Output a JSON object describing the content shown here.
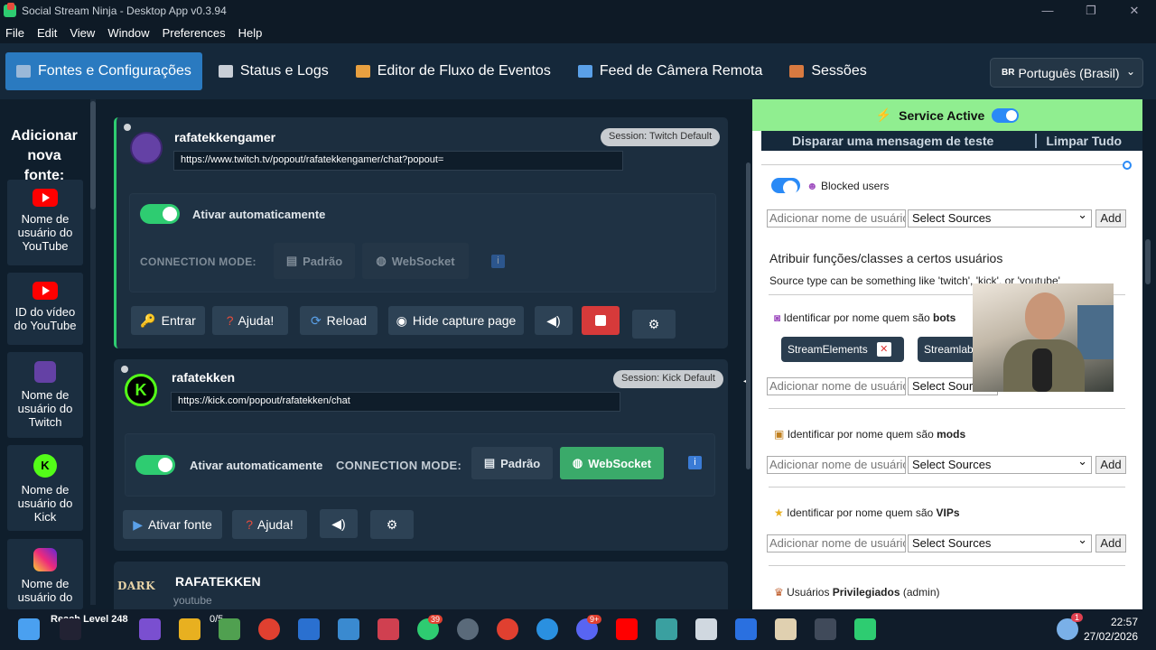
{
  "window": {
    "title": "Social Stream Ninja - Desktop App v0.3.94"
  },
  "menu": [
    "File",
    "Edit",
    "View",
    "Window",
    "Preferences",
    "Help"
  ],
  "tabs": [
    {
      "label": "Fontes e Configurações",
      "active": true
    },
    {
      "label": "Status e Logs"
    },
    {
      "label": "Editor de Fluxo de Eventos"
    },
    {
      "label": "Feed de Câmera Remota"
    },
    {
      "label": "Sessões"
    }
  ],
  "language": {
    "flag": "BR",
    "label": "Português (Brasil)"
  },
  "sidebar": {
    "heading": "Adicionar nova fonte:",
    "items": [
      {
        "label": "Nome de usuário do YouTube",
        "icon": "youtube-icon"
      },
      {
        "label": "ID do vídeo do YouTube",
        "icon": "youtube-icon"
      },
      {
        "label": "Nome de usuário do Twitch",
        "icon": "twitch-icon"
      },
      {
        "label": "Nome de usuário do Kick",
        "icon": "kick-icon"
      },
      {
        "label": "Nome de usuário do",
        "icon": "instagram-icon"
      }
    ]
  },
  "sources": [
    {
      "name": "rafatekkengamer",
      "url": "https://www.twitch.tv/popout/rafatekkengamer/chat?popout=",
      "session": "Session: Twitch Default",
      "auto_label": "Ativar automaticamente",
      "mode_label": "CONNECTION MODE:",
      "mode_options": [
        "Padrão",
        "WebSocket"
      ],
      "mode_selected": "none",
      "info": "i",
      "buttons": [
        "Entrar",
        "Ajuda!",
        "Reload",
        "Hide capture page"
      ]
    },
    {
      "name": "rafatekken",
      "url": "https://kick.com/popout/rafatekken/chat",
      "session": "Session: Kick Default",
      "auto_label": "Ativar automaticamente",
      "mode_label": "CONNECTION MODE:",
      "mode_options": [
        "Padrão",
        "WebSocket"
      ],
      "mode_selected": "WebSocket",
      "info": "i",
      "buttons": [
        "Ativar fonte",
        "Ajuda!"
      ]
    },
    {
      "name": "RAFATEKKEN",
      "platform": "youtube"
    }
  ],
  "right_panel": {
    "service": "Service Active",
    "test_message": "Disparar uma mensagem de teste",
    "clear_all": "Limpar Tudo",
    "blocked_users": "Blocked users",
    "input_placeholder": "Adicionar nome de usuário",
    "select_sources": "Select Sources",
    "select_sources_partial": "Select Sourc",
    "add": "Add",
    "roles_heading": "Atribuir funções/classes a certos usuários",
    "roles_hint": "Source type can be something like 'twitch', 'kick', or 'youtube'",
    "bots_prefix": "Identificar por nome quem são ",
    "bots_bold": "bots",
    "bot_chips": [
      "StreamElements",
      "Streamlab"
    ],
    "mods_prefix": "Identificar por nome quem são ",
    "mods_bold": "mods",
    "vips_prefix": "Identificar por nome quem são ",
    "vips_bold": "VIPs",
    "priv_prefix": "Usuários ",
    "priv_bold": "Privilegiados",
    "priv_suffix": " (admin)"
  },
  "game_overlay": {
    "title": "DARK EPOCH",
    "subtitle": "Reach Level 248",
    "progress": "0/5"
  },
  "taskbar": {
    "badge_whatsapp": "39",
    "badge_discord": "9+",
    "badge_weather": "1",
    "time": "22:57",
    "date": "27/02/2026"
  }
}
